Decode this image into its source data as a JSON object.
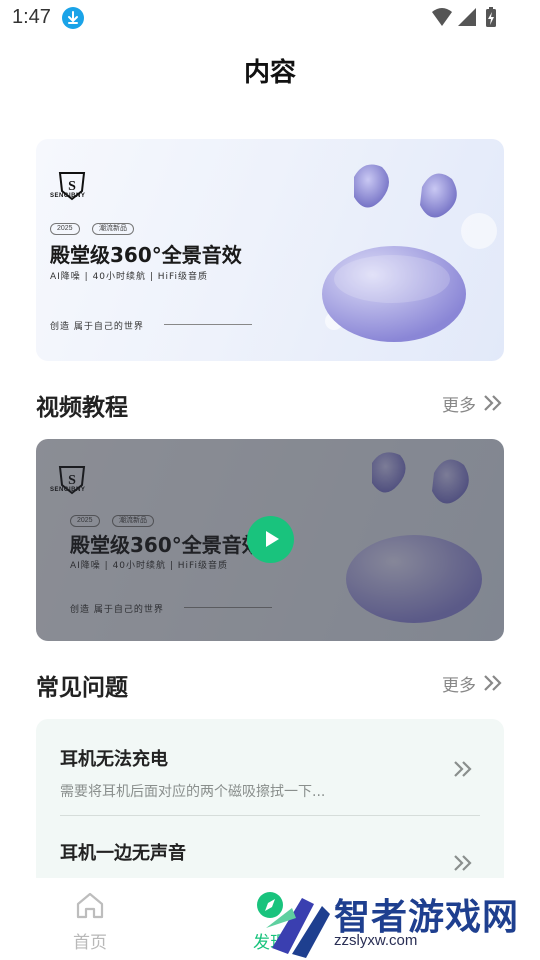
{
  "status_bar": {
    "time": "1:47"
  },
  "header": {
    "title": "内容"
  },
  "promo": {
    "brand": "SENGIBNY",
    "year_tag": "2025",
    "new_tag": "潮流新品",
    "headline": "殿堂级360°全景音效",
    "features": "AI降噪  |  40小时续航  |  HiFi级音质",
    "slogan": "创造 属于自己的世界"
  },
  "videos": {
    "title": "视频教程",
    "more": "更多"
  },
  "faq": {
    "title": "常见问题",
    "more": "更多",
    "items": [
      {
        "question": "耳机无法充电",
        "answer": "需要将耳机后面对应的两个磁吸擦拭一下..."
      },
      {
        "question": "耳机一边无声音",
        "answer": ""
      }
    ]
  },
  "tabs": [
    {
      "label": "首页",
      "icon": "home-icon"
    },
    {
      "label": "发现",
      "icon": "compass-icon"
    }
  ],
  "watermark": {
    "text": "智者游戏网",
    "url": "zzslyxw.com"
  },
  "colors": {
    "accent": "#19c37d",
    "faq_bg": "#f2f8f6",
    "muted": "#888888"
  }
}
